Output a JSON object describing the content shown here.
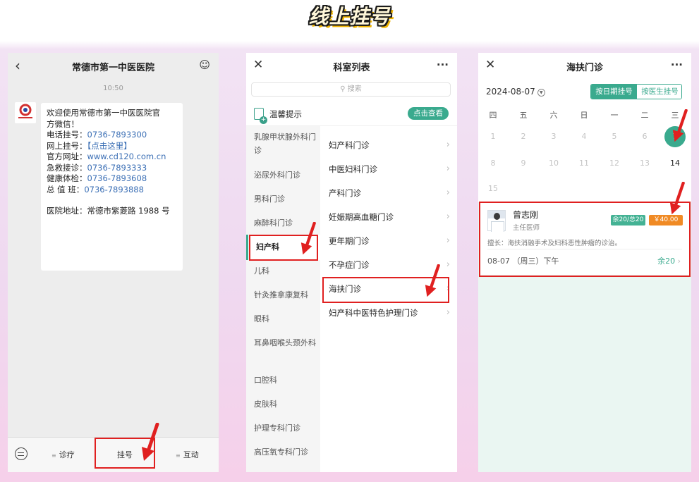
{
  "headline": "线上挂号",
  "screen1": {
    "title": "常德市第一中医医院",
    "time": "10:50",
    "message": {
      "lines": [
        "欢迎使用常德市第一中医医院官",
        "方微信！"
      ],
      "phone_label": "电话挂号：",
      "phone_value": "0736-7893300",
      "online_label": "网上挂号：",
      "online_value": "【点击这里】",
      "site_label": "官方网址：",
      "site_value": "www.cd120.com.cn",
      "er_label": "急救接诊：",
      "er_value": "0736-7893333",
      "check_label": "健康体检：",
      "check_value": "0736-7893608",
      "duty_label": "总 值 班：",
      "duty_value": "0736-7893888",
      "address": "医院地址：常德市紫菱路 1988 号"
    },
    "menu": {
      "item1": "诊疗",
      "item2": "挂号",
      "item3": "互动"
    }
  },
  "screen2": {
    "title": "科室列表",
    "search_placeholder": "搜索",
    "tip_label": "温馨提示",
    "tip_button": "点击查看",
    "departments": [
      "乳腺甲状腺外科门诊",
      "泌尿外科门诊",
      "男科门诊",
      "麻醉科门诊",
      "妇产科",
      "儿科",
      "针灸推拿康复科",
      "眼科",
      "耳鼻咽喉头颈外科",
      "口腔科",
      "皮肤科",
      "护理专科门诊",
      "高压氧专科门诊"
    ],
    "clinics": [
      "妇产科门诊",
      "中医妇科门诊",
      "产科门诊",
      "妊娠期高血糖门诊",
      "更年期门诊",
      "不孕症门诊",
      "海扶门诊",
      "妇产科中医特色护理门诊"
    ]
  },
  "screen3": {
    "title": "海扶门诊",
    "date": "2024-08-07",
    "tab_date": "按日期挂号",
    "tab_doctor": "按医生挂号",
    "weekdays": [
      "四",
      "五",
      "六",
      "日",
      "一",
      "二",
      "三"
    ],
    "week1": [
      "1",
      "2",
      "3",
      "4",
      "5",
      "6",
      "7"
    ],
    "week2": [
      "8",
      "9",
      "10",
      "11",
      "12",
      "13",
      "14"
    ],
    "week3": [
      "15"
    ],
    "doctor": {
      "name": "曾志刚",
      "title": "主任医师",
      "quota_badge": "余20/总20",
      "fee_badge": "￥40.00",
      "specialty": "擅长：海扶消融手术及妇科恶性肿瘤的诊治。",
      "slot": "08-07 （周三）下午",
      "remaining": "余20"
    }
  }
}
